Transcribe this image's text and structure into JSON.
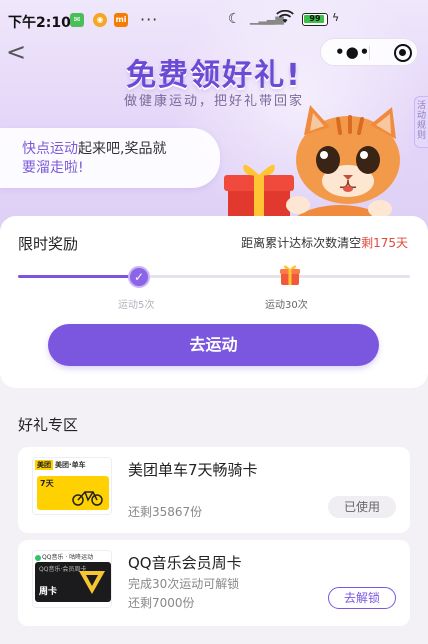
{
  "status_bar": {
    "time": "下午2:10",
    "app_icons": [
      "wechat-icon",
      "weibo-icon",
      "mi-icon"
    ],
    "more": "···",
    "battery": "99",
    "battery_level": 0.99
  },
  "header": {
    "back": "<",
    "title": "免费领好礼!",
    "subtitle": "做健康运动，把好礼带回家",
    "rules_tab": "活动规则"
  },
  "speech": {
    "highlight": "快点运动",
    "line1_rest": "起来吧,奖品就",
    "line2": "要溜走啦!"
  },
  "reward": {
    "title": "限时奖励",
    "note_prefix": "距离累计达标次数清空",
    "note_days": "剩175天",
    "progress_fraction": 0.3,
    "milestones": [
      {
        "label": "运动5次",
        "status": "done"
      },
      {
        "label": "运动30次",
        "status": "gift"
      }
    ],
    "button": "去运动"
  },
  "gifts": {
    "section_title": "好礼专区",
    "items": [
      {
        "name": "美团单车7天畅骑卡",
        "remain": "还剩35867份",
        "button": "已使用",
        "thumb_brand": "美团·单车",
        "thumb_text": "7天"
      },
      {
        "name": "QQ音乐会员周卡",
        "condition": "完成30次运动可解锁",
        "remain": "还剩7000份",
        "button": "去解锁",
        "thumb_brand": "QQ音乐 · 咕咚运动",
        "thumb_text": "QQ音乐·会员周卡",
        "thumb_week": "周卡"
      }
    ]
  },
  "colors": {
    "accent": "#7b56df",
    "highlight_red": "#e0493b"
  }
}
